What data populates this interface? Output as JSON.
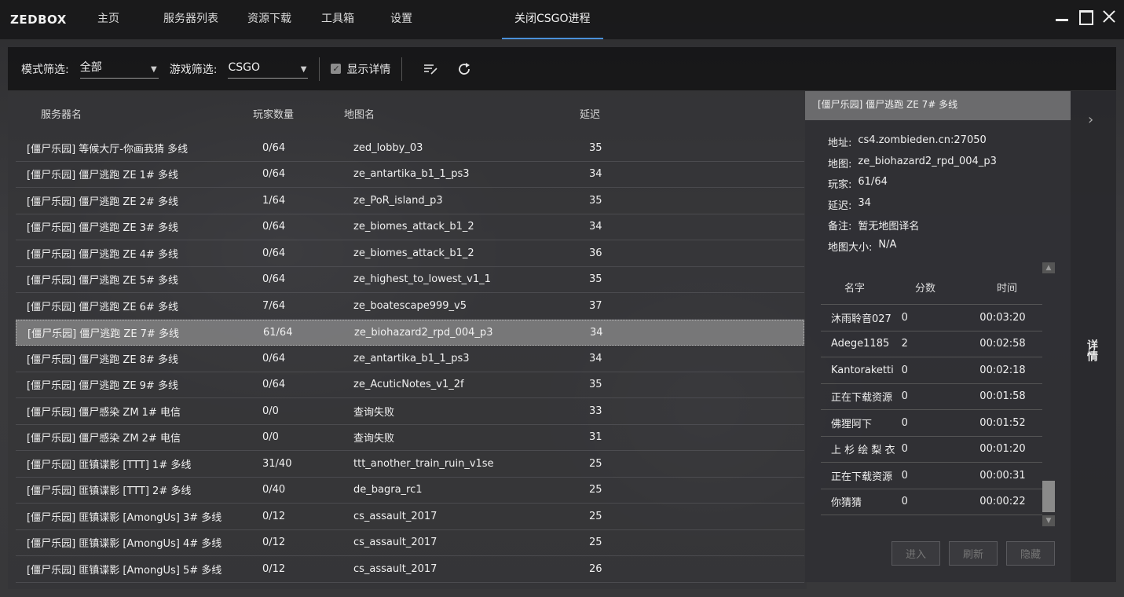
{
  "app": {
    "title": "ZEDBOX"
  },
  "nav": {
    "tabs": [
      {
        "label": "主页"
      },
      {
        "label": "服务器列表"
      },
      {
        "label": "资源下载"
      },
      {
        "label": "工具箱"
      },
      {
        "label": "设置"
      },
      {
        "label": "关闭CSGO进程"
      }
    ],
    "active_tab": "关闭CSGO进程",
    "accent_color": "#4a90d9"
  },
  "toolbar": {
    "mode_filter_label": "模式筛选:",
    "mode_filter_value": "全部",
    "game_filter_label": "游戏筛选:",
    "game_filter_value": "CSGO",
    "show_details_label": "显示详情",
    "show_details_checked": true,
    "edit_icon": "edit-list-icon",
    "refresh_icon": "refresh-icon"
  },
  "server_list": {
    "columns": [
      "服务器名",
      "玩家数量",
      "地图名",
      "延迟"
    ],
    "rows": [
      {
        "name": "[僵尸乐园] 等候大厅-你画我猜 多线",
        "players": "0/64",
        "map": "zed_lobby_03",
        "ping": "35"
      },
      {
        "name": "[僵尸乐园] 僵尸逃跑 ZE 1# 多线",
        "players": "0/64",
        "map": "ze_antartika_b1_1_ps3",
        "ping": "34"
      },
      {
        "name": "[僵尸乐园] 僵尸逃跑 ZE 2# 多线",
        "players": "1/64",
        "map": "ze_PoR_island_p3",
        "ping": "35"
      },
      {
        "name": "[僵尸乐园] 僵尸逃跑 ZE 3# 多线",
        "players": "0/64",
        "map": "ze_biomes_attack_b1_2",
        "ping": "34"
      },
      {
        "name": "[僵尸乐园] 僵尸逃跑 ZE 4# 多线",
        "players": "0/64",
        "map": "ze_biomes_attack_b1_2",
        "ping": "36"
      },
      {
        "name": "[僵尸乐园] 僵尸逃跑 ZE 5# 多线",
        "players": "0/64",
        "map": "ze_highest_to_lowest_v1_1",
        "ping": "35"
      },
      {
        "name": "[僵尸乐园] 僵尸逃跑 ZE 6# 多线",
        "players": "7/64",
        "map": "ze_boatescape999_v5",
        "ping": "37"
      },
      {
        "name": "[僵尸乐园] 僵尸逃跑 ZE 7# 多线",
        "players": "61/64",
        "map": "ze_biohazard2_rpd_004_p3",
        "ping": "34"
      },
      {
        "name": "[僵尸乐园] 僵尸逃跑 ZE 8# 多线",
        "players": "0/64",
        "map": "ze_antartika_b1_1_ps3",
        "ping": "34"
      },
      {
        "name": "[僵尸乐园] 僵尸逃跑 ZE 9# 多线",
        "players": "0/64",
        "map": "ze_AcuticNotes_v1_2f",
        "ping": "35"
      },
      {
        "name": "[僵尸乐园] 僵尸感染 ZM 1# 电信",
        "players": "0/0",
        "map": "查询失败",
        "ping": "33"
      },
      {
        "name": "[僵尸乐园] 僵尸感染 ZM 2# 电信",
        "players": "0/0",
        "map": "查询失败",
        "ping": "31"
      },
      {
        "name": "[僵尸乐园] 匪镇谍影 [TTT] 1# 多线",
        "players": "31/40",
        "map": "ttt_another_train_ruin_v1se",
        "ping": "25"
      },
      {
        "name": "[僵尸乐园] 匪镇谍影 [TTT] 2# 多线",
        "players": "0/40",
        "map": "de_bagra_rc1",
        "ping": "25"
      },
      {
        "name": "[僵尸乐园] 匪镇谍影 [AmongUs] 3# 多线",
        "players": "0/12",
        "map": "cs_assault_2017",
        "ping": "25"
      },
      {
        "name": "[僵尸乐园] 匪镇谍影 [AmongUs] 4# 多线",
        "players": "0/12",
        "map": "cs_assault_2017",
        "ping": "25"
      },
      {
        "name": "[僵尸乐园] 匪镇谍影 [AmongUs] 5# 多线",
        "players": "0/12",
        "map": "cs_assault_2017",
        "ping": "26"
      }
    ],
    "selected_index": 7
  },
  "details": {
    "title": "[僵尸乐园] 僵尸逃跑 ZE 7# 多线",
    "info": [
      {
        "key": "地址:",
        "value": "cs4.zombieden.cn:27050"
      },
      {
        "key": "地图:",
        "value": "ze_biohazard2_rpd_004_p3"
      },
      {
        "key": "玩家:",
        "value": "61/64"
      },
      {
        "key": "延迟:",
        "value": "34"
      },
      {
        "key": "备注:",
        "value": "暂无地图译名"
      },
      {
        "key": "地图大小:",
        "value": "N/A"
      }
    ],
    "player_columns": [
      "名字",
      "分数",
      "时间"
    ],
    "players": [
      {
        "name": "沐雨聆音027",
        "score": "0",
        "time": "00:03:20"
      },
      {
        "name": "Adege1185",
        "score": "2",
        "time": "00:02:58"
      },
      {
        "name": "Kantoraketti",
        "score": "0",
        "time": "00:02:18"
      },
      {
        "name": "正在下载资源",
        "score": "0",
        "time": "00:01:58"
      },
      {
        "name": "佛狸阿下",
        "score": "0",
        "time": "00:01:52"
      },
      {
        "name": "上 杉 绘 梨 衣",
        "score": "0",
        "time": "00:01:20"
      },
      {
        "name": "正在下载资源",
        "score": "0",
        "time": "00:00:31"
      },
      {
        "name": "你猜猜",
        "score": "0",
        "time": "00:00:22"
      }
    ],
    "buttons": {
      "join": "进入",
      "refresh": "刷新",
      "hide": "隐藏"
    }
  },
  "side_panel": {
    "label": "详情",
    "arrow_icon": "chevron-right-icon"
  }
}
